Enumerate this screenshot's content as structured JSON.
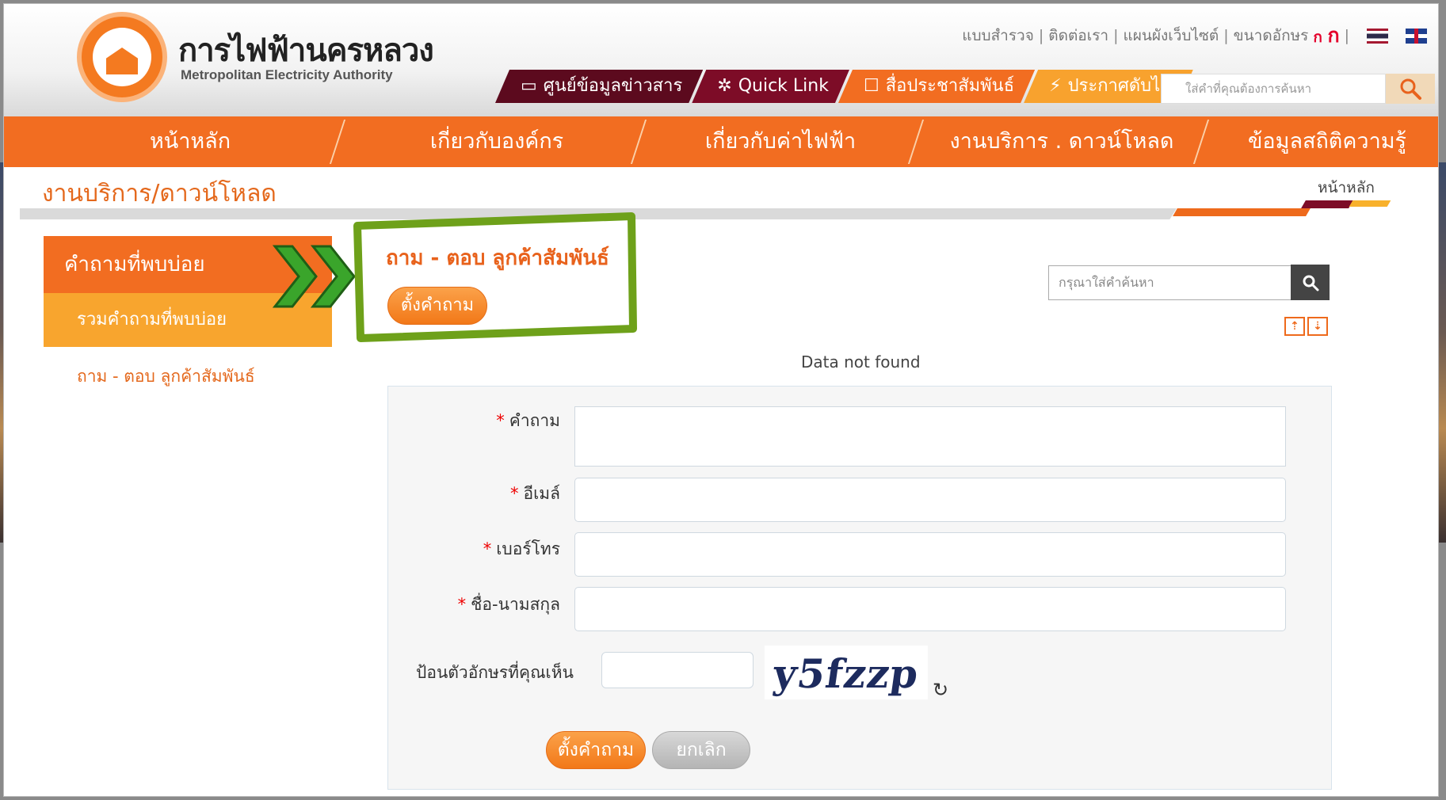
{
  "brand": {
    "name_th": "การไฟฟ้านครหลวง",
    "name_en": "Metropolitan Electricity Authority",
    "colors": {
      "primary": "#f26d21",
      "maroon": "#7d0c27",
      "yellow": "#f8a22e",
      "callout": "#6ea11a"
    }
  },
  "top_links": {
    "survey": "แบบสำรวจ",
    "contact": "ติดต่อเรา",
    "sitemap": "แผนผังเว็บไซต์",
    "font_size_label": "ขนาดอักษร",
    "font_small": "ก",
    "font_large": "ก",
    "separator": "|",
    "lang_icons": [
      "thai-flag-icon",
      "uk-flag-icon"
    ]
  },
  "subnav": {
    "items": [
      {
        "icon": "▭",
        "label": "ศูนย์ข้อมูลข่าวสาร"
      },
      {
        "icon": "✲",
        "label": "Quick Link"
      },
      {
        "icon": "☐",
        "label": "สื่อประชาสัมพันธ์"
      },
      {
        "icon": "⚡",
        "label": "ประกาศดับไฟ"
      }
    ],
    "search_placeholder": "ใส่คำที่คุณต้องการค้นหา"
  },
  "main_nav": [
    "หน้าหลัก",
    "เกี่ยวกับองค์กร",
    "เกี่ยวกับค่าไฟฟ้า",
    "งานบริการ . ดาวน์โหลด",
    "ข้อมูลสถิติความรู้"
  ],
  "page": {
    "heading": "งานบริการ/ดาวน์โหลด",
    "home_link": "หน้าหลัก"
  },
  "sidebar": {
    "header": "คำถามที่พบบ่อย",
    "active_item": "รวมคำถามที่พบบ่อย",
    "link": "ถาม - ตอบ ลูกค้าสัมพันธ์"
  },
  "faq": {
    "title": "ถาม - ตอบ ลูกค้าสัมพันธ์",
    "ask_button": "ตั้งคำถาม",
    "search_placeholder": "กรุณาใส่คำค้นหา",
    "no_data": "Data not found"
  },
  "form": {
    "required_mark": "*",
    "question_label": "คำถาม",
    "email_label": "อีเมล์",
    "phone_label": "เบอร์โทร",
    "name_label": "ชื่อ-นามสกุล",
    "captcha_label": "ป้อนตัวอักษรที่คุณเห็น",
    "captcha_text": "y5fzzp",
    "refresh_icon": "↻",
    "submit": "ตั้งคำถาม",
    "cancel": "ยกเลิก"
  }
}
